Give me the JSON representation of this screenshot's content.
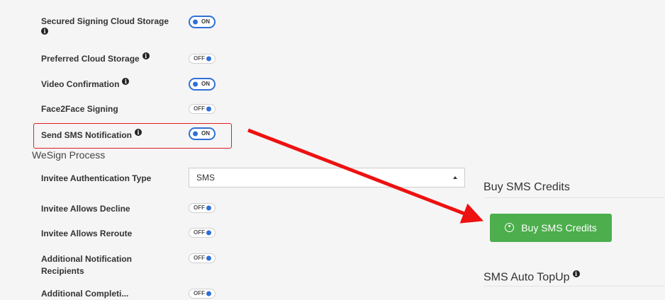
{
  "settings": {
    "secured_storage_label": "Secured Signing Cloud Storage",
    "preferred_storage_label": "Preferred Cloud Storage",
    "video_confirmation_label": "Video Confirmation",
    "face2face_label": "Face2Face Signing",
    "send_sms_label": "Send SMS Notification"
  },
  "toggles": {
    "on_text": "ON",
    "off_text": "OFF"
  },
  "process": {
    "title": "WeSign Process",
    "auth_type_label": "Invitee Authentication Type",
    "auth_type_value": "SMS",
    "allows_decline_label": "Invitee Allows Decline",
    "allows_reroute_label": "Invitee Allows Reroute",
    "additional_recipients_label_line1": "Additional Notification",
    "additional_recipients_label_line2": "Recipients",
    "next_label_partial": "Additional Completi..."
  },
  "right": {
    "buy_title": "Buy SMS Credits",
    "buy_button_label": "Buy SMS Credits",
    "autotopup_title": "SMS Auto TopUp"
  },
  "colors": {
    "accent_blue": "#2f6fd8",
    "button_green": "#4cae4c",
    "highlight_red": "#e02020"
  }
}
